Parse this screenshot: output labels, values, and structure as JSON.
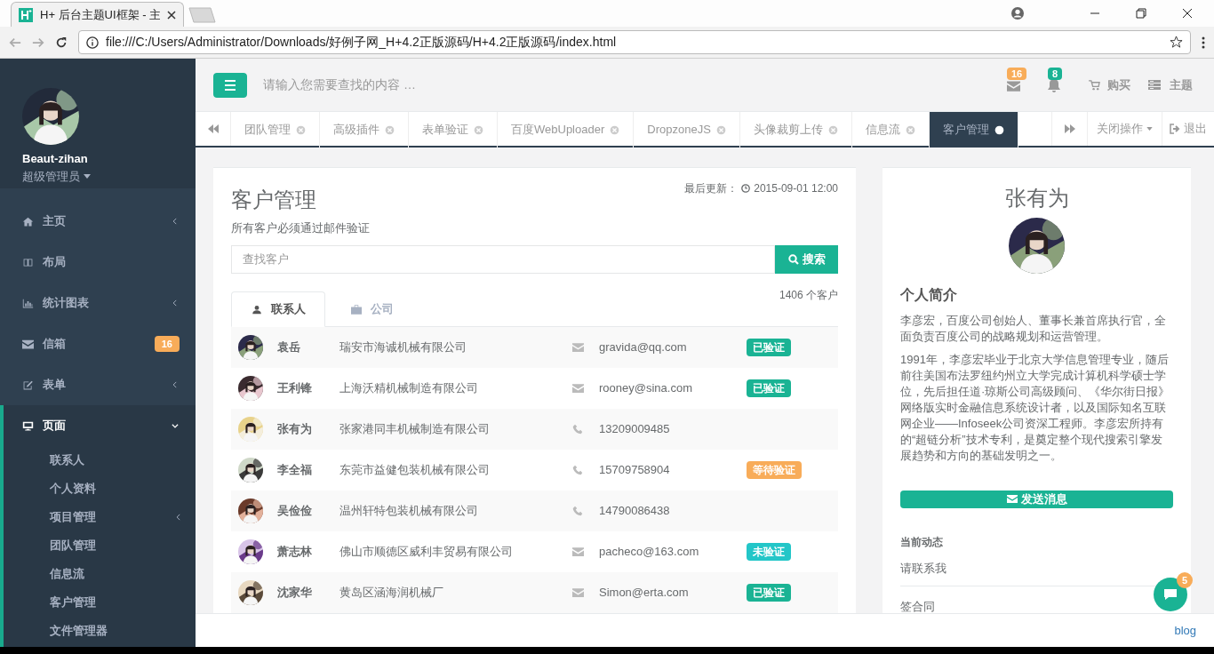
{
  "browser": {
    "tab_title": "H+ 后台主题UI框架 - 主",
    "url": "file:///C:/Users/Administrator/Downloads/好例子网_H+4.2正版源码/H+4.2正版源码/index.html"
  },
  "sidebar": {
    "user_name": "Beaut-zihan",
    "user_role": "超级管理员",
    "items": [
      {
        "label": "主页",
        "kind": "home",
        "has_submenu": true,
        "expanded": false
      },
      {
        "label": "布局",
        "kind": "columns",
        "has_submenu": false,
        "expanded": false
      },
      {
        "label": "统计图表",
        "kind": "chart",
        "has_submenu": true,
        "expanded": false
      },
      {
        "label": "信箱",
        "kind": "mail",
        "badge": "16",
        "has_submenu": false,
        "expanded": false
      },
      {
        "label": "表单",
        "kind": "edit",
        "has_submenu": true,
        "expanded": false
      },
      {
        "label": "页面",
        "kind": "monitor",
        "has_submenu": true,
        "expanded": true,
        "children": [
          {
            "label": "联系人",
            "has_submenu": false
          },
          {
            "label": "个人资料",
            "has_submenu": false
          },
          {
            "label": "项目管理",
            "has_submenu": true
          },
          {
            "label": "团队管理",
            "has_submenu": false
          },
          {
            "label": "信息流",
            "has_submenu": false
          },
          {
            "label": "客户管理",
            "has_submenu": false
          },
          {
            "label": "文件管理器",
            "has_submenu": false
          }
        ]
      }
    ]
  },
  "topbar": {
    "search_placeholder": "请输入您需要查找的内容 …",
    "mail_count": "16",
    "bell_count": "8",
    "buy": "购买",
    "theme": "主题"
  },
  "page_tabs": [
    {
      "label": "团队管理",
      "selected": false
    },
    {
      "label": "高级插件",
      "selected": false
    },
    {
      "label": "表单验证",
      "selected": false
    },
    {
      "label": "百度WebUploader",
      "selected": false
    },
    {
      "label": "DropzoneJS",
      "selected": false
    },
    {
      "label": "头像裁剪上传",
      "selected": false
    },
    {
      "label": "信息流",
      "selected": false
    },
    {
      "label": "客户管理",
      "selected": true
    }
  ],
  "tab_actions": {
    "close_ops": "关闭操作",
    "logout": "退出"
  },
  "customers": {
    "title": "客户管理",
    "updated_label": "最后更新：",
    "updated_time": "2015-09-01 12:00",
    "subtitle": "所有客户必须通过邮件验证",
    "search_placeholder": "查找客户",
    "search_button": "搜索",
    "count": "1406 个客户",
    "tabs": [
      {
        "label": "联系人",
        "kind": "user",
        "selected": true
      },
      {
        "label": "公司",
        "kind": "briefcase",
        "selected": false
      }
    ],
    "rows": [
      {
        "name": "袁岳",
        "company": "瑞安市海诚机械有限公司",
        "kind": "mail",
        "contact": "gravida@qq.com",
        "status": "已验证",
        "color": "#1ab394"
      },
      {
        "name": "王利锋",
        "company": "上海沃精机械制造有限公司",
        "kind": "mail",
        "contact": "rooney@sina.com",
        "status": "已验证",
        "color": "#1ab394"
      },
      {
        "name": "张有为",
        "company": "张家港同丰机械制造有限公司",
        "kind": "phone",
        "contact": "13209009485"
      },
      {
        "name": "李全福",
        "company": "东莞市益健包装机械有限公司",
        "kind": "phone",
        "contact": "15709758904",
        "status": "等待验证",
        "color": "#f8ac59"
      },
      {
        "name": "吴俭俭",
        "company": "温州轩特包装机械有限公司",
        "kind": "phone",
        "contact": "14790086438"
      },
      {
        "name": "萧志林",
        "company": "佛山市顺德区威利丰贸易有限公司",
        "kind": "mail",
        "contact": "pacheco@163.com",
        "status": "未验证",
        "color": "#23c6c8"
      },
      {
        "name": "沈家华",
        "company": "黄岛区涵海润机械厂",
        "kind": "mail",
        "contact": "Simon@erta.com",
        "status": "已验证",
        "color": "#1ab394"
      }
    ]
  },
  "profile": {
    "name": "张有为",
    "bio_title": "个人简介",
    "bio": [
      "李彦宏，百度公司创始人、董事长兼首席执行官，全面负责百度公司的战略规划和运营管理。",
      "1991年，李彦宏毕业于北京大学信息管理专业，随后前往美国布法罗纽约州立大学完成计算机科学硕士学位，先后担任道·琼斯公司高级顾问、《华尔街日报》网络版实时金融信息系统设计者，以及国际知名互联网企业——Infoseek公司资深工程师。李彦宏所持有的“超链分析”技术专利，是奠定整个现代搜索引擎发展趋势和方向的基础发明之一。"
    ],
    "send_button": "发送消息",
    "activity_title": "当前动态",
    "activities": [
      "请联系我",
      "签合同"
    ]
  },
  "chat_badge": "5",
  "footer_link": "blog"
}
